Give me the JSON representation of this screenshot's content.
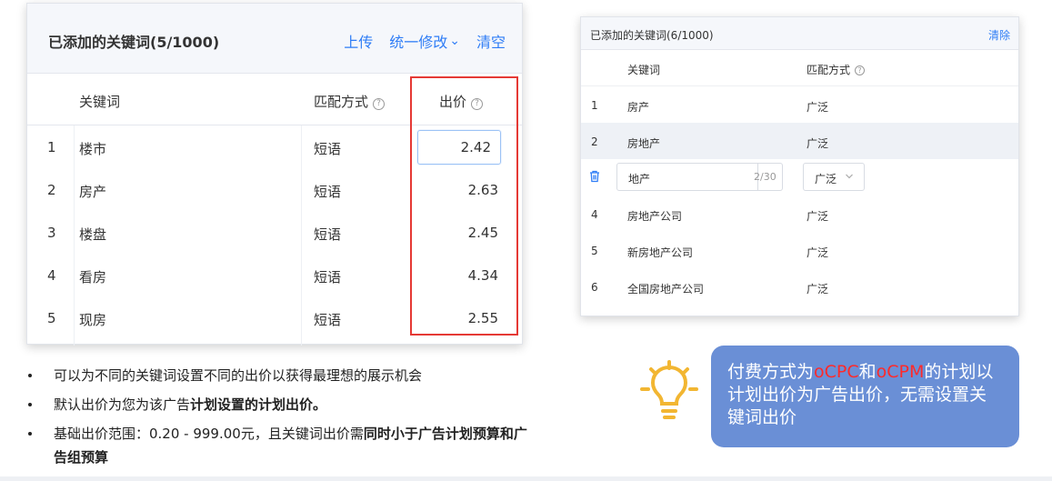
{
  "left_panel": {
    "title": "已添加的关键词(5/1000)",
    "actions": {
      "upload": "上传",
      "batch_edit": "统一修改",
      "batch_edit_chevron": "⌄",
      "clear": "清空"
    },
    "columns": {
      "keyword": "关键词",
      "match": "匹配方式",
      "bid": "出价",
      "help": "?"
    },
    "rows": [
      {
        "index": "1",
        "keyword": "楼市",
        "match": "短语",
        "bid": "2.42"
      },
      {
        "index": "2",
        "keyword": "房产",
        "match": "短语",
        "bid": "2.63"
      },
      {
        "index": "3",
        "keyword": "楼盘",
        "match": "短语",
        "bid": "2.45"
      },
      {
        "index": "4",
        "keyword": "看房",
        "match": "短语",
        "bid": "4.34"
      },
      {
        "index": "5",
        "keyword": "现房",
        "match": "短语",
        "bid": "2.55"
      }
    ]
  },
  "right_panel": {
    "title": "已添加的关键词(6/1000)",
    "clear": "清除",
    "columns": {
      "keyword": "关键词",
      "match": "匹配方式",
      "help": "?"
    },
    "rows": [
      {
        "index": "1",
        "keyword": "房产",
        "match": "广泛"
      },
      {
        "index": "2",
        "keyword": "房地产",
        "match": "广泛"
      },
      {
        "index": "",
        "keyword": "地产",
        "counter": "2/30",
        "match": "广泛",
        "editing": true
      },
      {
        "index": "4",
        "keyword": "房地产公司",
        "match": "广泛"
      },
      {
        "index": "5",
        "keyword": "新房地产公司",
        "match": "广泛"
      },
      {
        "index": "6",
        "keyword": "全国房地产公司",
        "match": "广泛"
      }
    ]
  },
  "bullets": {
    "b1": "可以为不同的关键词设置不同的出价以获得最理想的展示机会",
    "b2_pre": "默认出价为您为该广告",
    "b2_bold": "计划设置的计划出价。",
    "b3_pre": "基础出价范围：0.20 - 999.00元，且关键词出价需",
    "b3_bold": "同时小于广告计划预算和广告组预算"
  },
  "callout": {
    "t1": "付费方式为",
    "red1": "oCPC",
    "t2": "和",
    "red2": "oCPM",
    "t3": "的计划以计划出价为广告出价，无需设置关键词出价"
  },
  "colors": {
    "accent": "#2f7df6",
    "highlight_box": "#e53935",
    "callout_bg": "#6a8fd6",
    "bulb": "#f2b632"
  },
  "icons": {
    "trash": "trash-icon",
    "help": "help-circle-icon",
    "bulb": "lightbulb-icon"
  }
}
